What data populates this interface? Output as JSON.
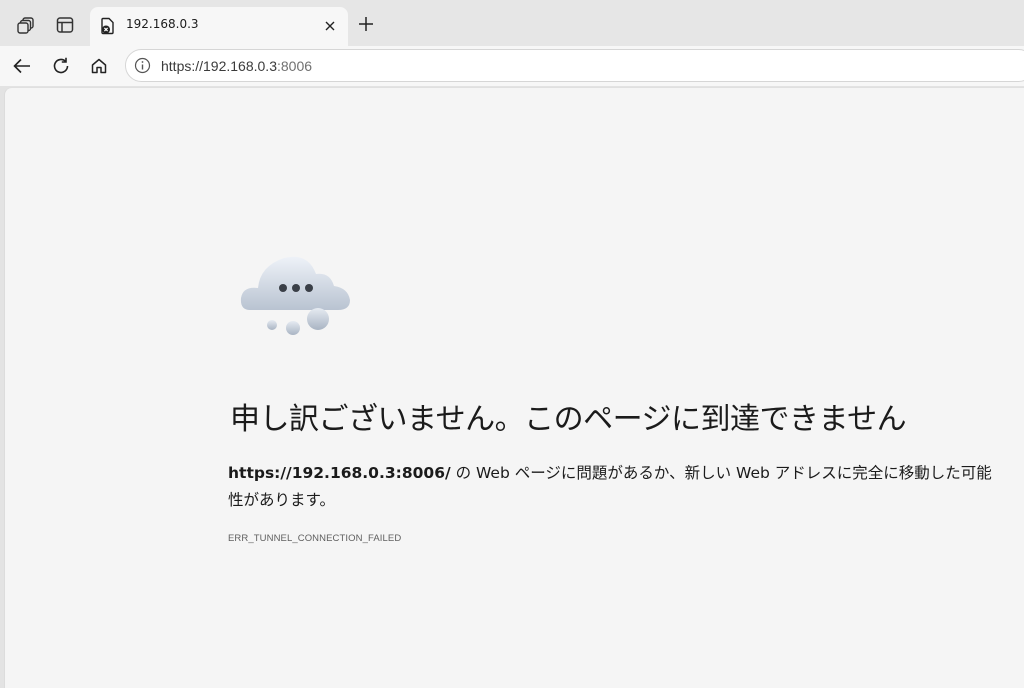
{
  "tab": {
    "title": "192.168.0.3",
    "close_label": "×",
    "new_tab_label": "+"
  },
  "toolbar": {
    "address_host": "https://192.168.0.3",
    "address_port": ":8006"
  },
  "error": {
    "title": "申し訳ございません。このページに到達できません",
    "url": "https://192.168.0.3:8006/",
    "message": " の Web ページに問題があるか、新しい Web アドレスに完全に移動した可能性があります。",
    "code": "ERR_TUNNEL_CONNECTION_FAILED"
  },
  "icons": {
    "workspaces": "workspaces-icon",
    "tab_actions": "tab-actions-icon",
    "favicon": "broken-page-icon",
    "back": "back-arrow-icon",
    "refresh": "refresh-icon",
    "home": "home-icon",
    "site_info": "info-icon",
    "error_illustration": "cloud-icon"
  },
  "colors": {
    "page_bg": "#f5f5f5",
    "tabbar_bg": "#e6e6e6",
    "text": "#1b1b1b"
  }
}
